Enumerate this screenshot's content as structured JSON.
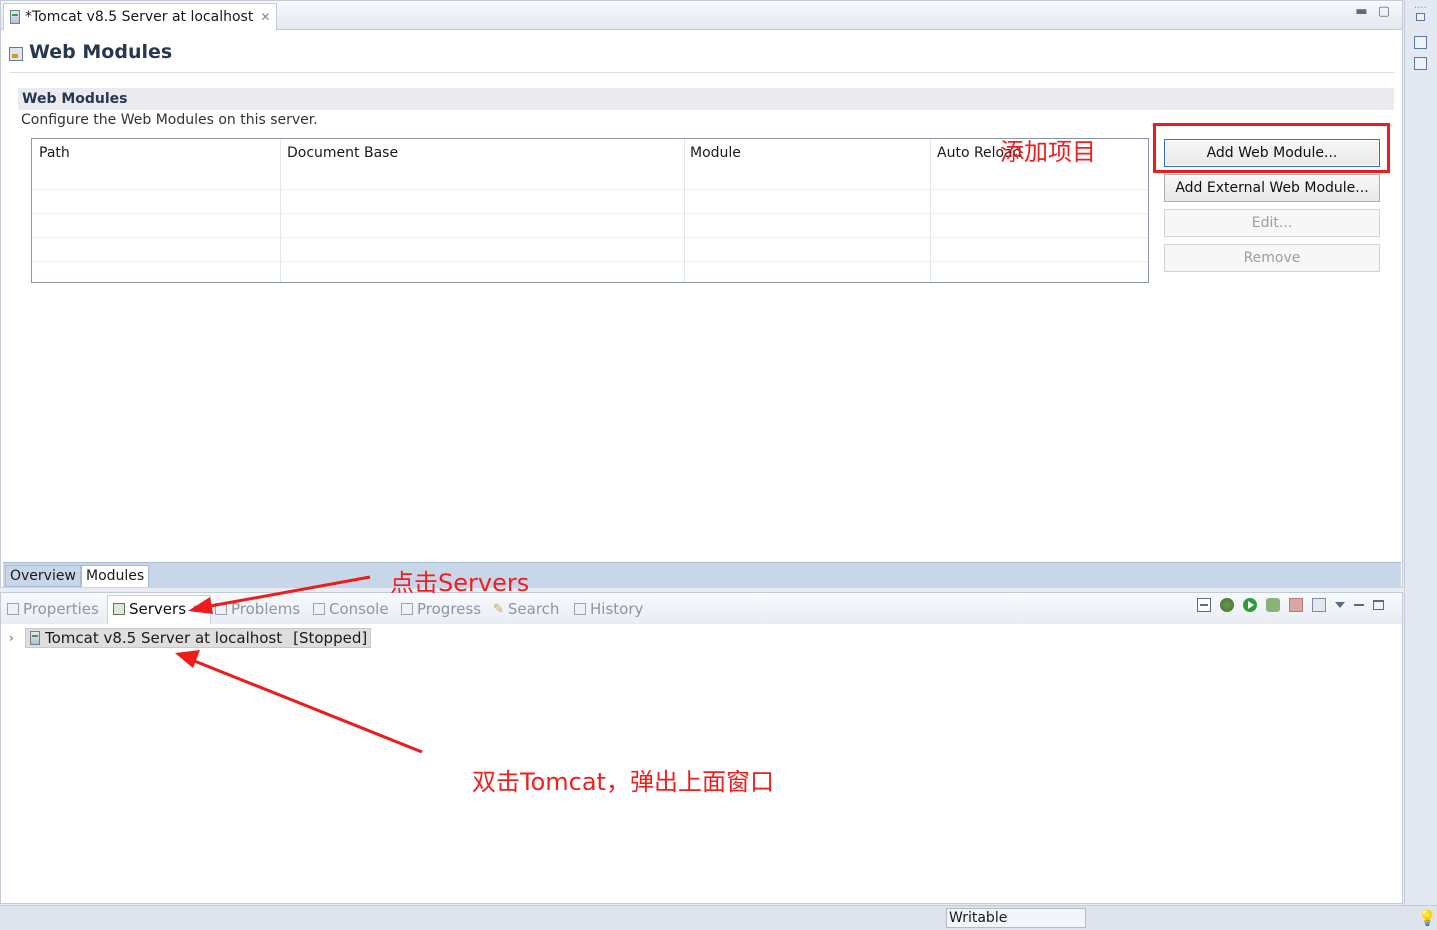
{
  "editor": {
    "tab_title": "*Tomcat v8.5 Server at localhost",
    "page_title": "Web Modules",
    "section": {
      "title": "Web Modules",
      "description": "Configure the Web Modules on this server."
    },
    "table": {
      "columns": [
        "Path",
        "Document Base",
        "Module",
        "Auto Reload"
      ],
      "rows": []
    },
    "buttons": {
      "add_web_module": "Add Web Module...",
      "add_external_web_module": "Add External Web Module...",
      "edit": "Edit...",
      "remove": "Remove"
    },
    "bottom_tabs": [
      "Overview",
      "Modules"
    ],
    "active_bottom_tab": "Modules"
  },
  "views": {
    "tabs": [
      "Properties",
      "Servers",
      "Problems",
      "Console",
      "Progress",
      "Search",
      "History"
    ],
    "active_tab": "Servers",
    "servers": [
      {
        "name": "Tomcat v8.5 Server at localhost",
        "state": "[Stopped]"
      }
    ]
  },
  "statusbar": {
    "writable": "Writable"
  },
  "annotations": {
    "add_project": "添加项目",
    "click_servers": "点击Servers",
    "double_click_tomcat": "双击Tomcat，弹出上面窗口",
    "color": "#f21e1e"
  },
  "colors": {
    "accent_blue": "#2d6fd6",
    "tab_bar": "#c8d6ea",
    "status_bar": "#dde4ee"
  }
}
